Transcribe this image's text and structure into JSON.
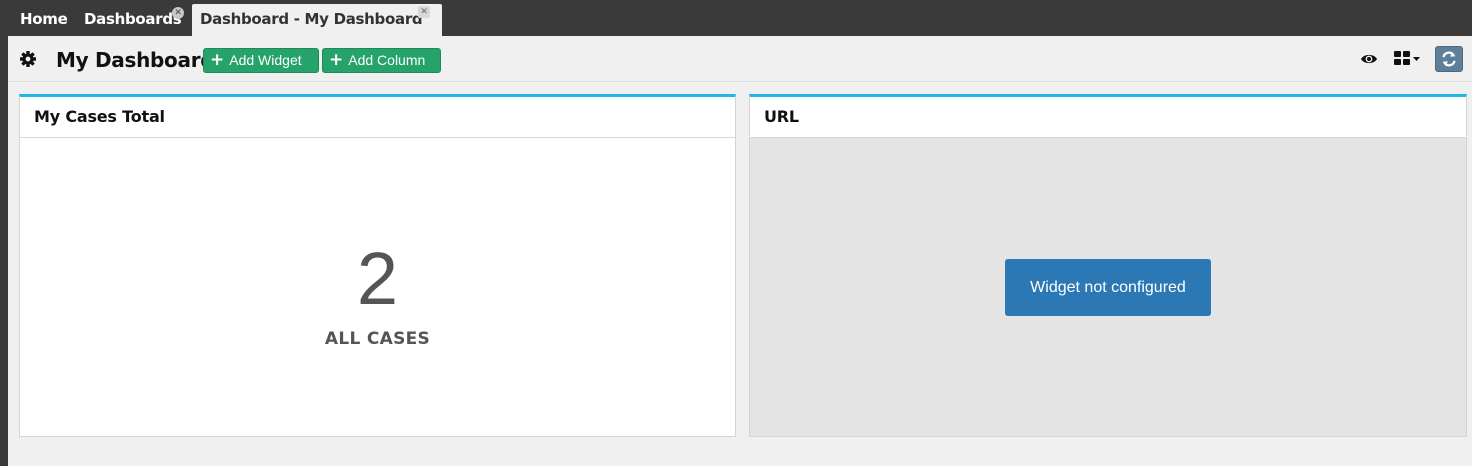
{
  "tabs": [
    {
      "label": "Home"
    },
    {
      "label": "Dashboards"
    },
    {
      "label": "Dashboard - My Dashboard"
    }
  ],
  "toolbar": {
    "title": "My Dashboard",
    "add_widget_label": "Add Widget",
    "add_column_label": "Add Column"
  },
  "widgets": [
    {
      "title": "My Cases Total",
      "value": "2",
      "label": "ALL CASES"
    },
    {
      "title": "URL",
      "message": "Widget not configured"
    }
  ],
  "colors": {
    "accent": "#1fb6e8",
    "button_green": "#25a36b",
    "info_blue": "#2b78b4",
    "tabbar": "#3a3a3a"
  },
  "icons": [
    "gear-icon",
    "plus-icon",
    "eye-icon",
    "grid-layout-icon",
    "caret-down-icon",
    "refresh-icon",
    "close-icon"
  ]
}
